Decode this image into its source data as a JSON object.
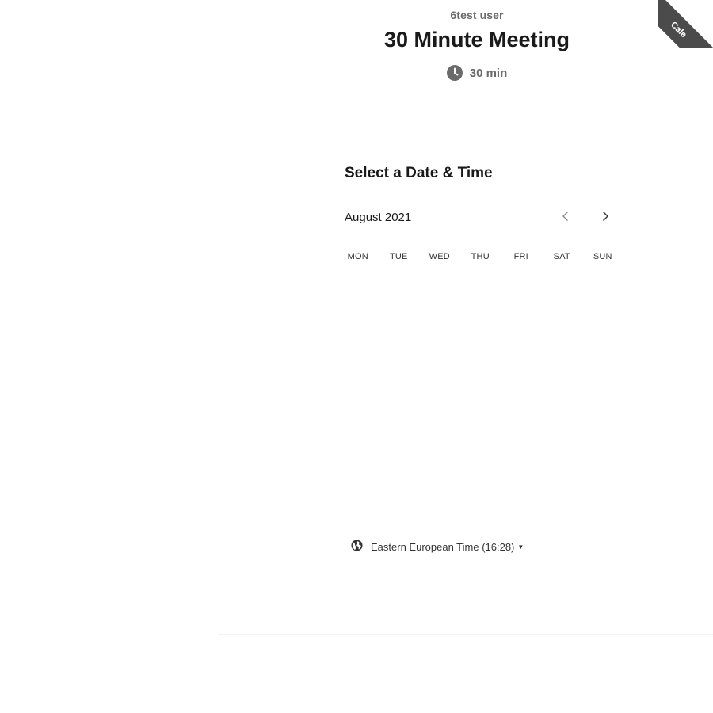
{
  "header": {
    "owner_name": "6test user",
    "event_title": "30 Minute Meeting",
    "duration": "30 min"
  },
  "calendar": {
    "section_title": "Select a Date & Time",
    "month_label": "August 2021",
    "weekdays": [
      "MON",
      "TUE",
      "WED",
      "THU",
      "FRI",
      "SAT",
      "SUN"
    ]
  },
  "timezone": {
    "label": "Eastern European Time (16:28)"
  },
  "ribbon": {
    "text": "Cale"
  },
  "colors": {
    "text_primary": "#1a1a1a",
    "text_secondary": "#6b6b6b",
    "ribbon_bg": "#4b4b4b"
  }
}
